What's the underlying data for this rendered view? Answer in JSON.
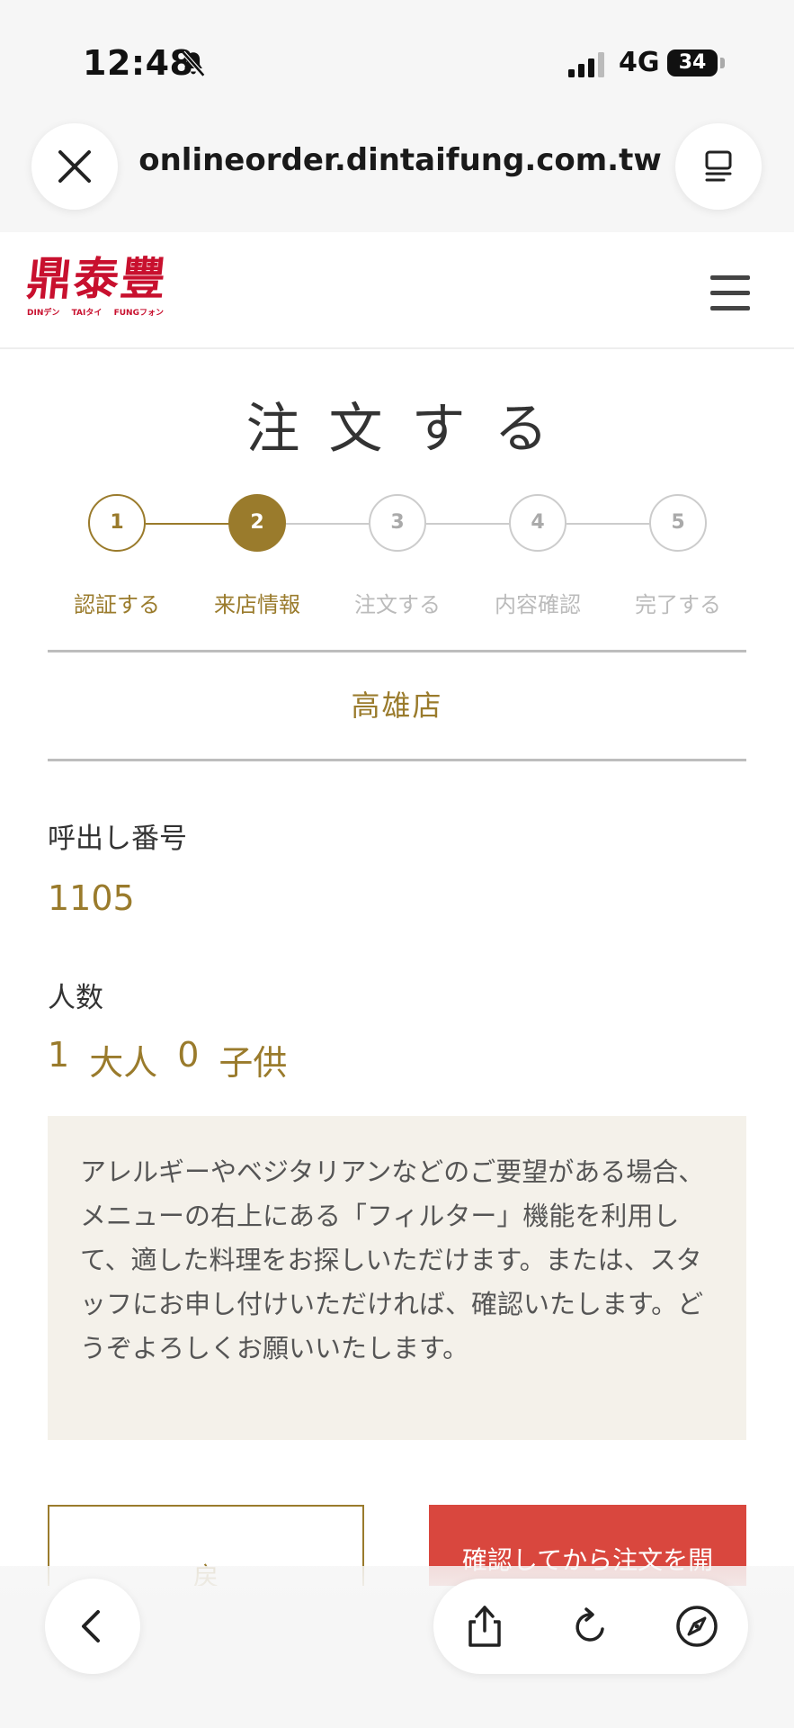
{
  "status_bar": {
    "time": "12:48",
    "network": "4G",
    "battery": "34"
  },
  "browser": {
    "url": "onlineorder.dintaifung.com.tw",
    "close_icon": "close-icon",
    "reader_icon": "reader-mode-icon"
  },
  "header": {
    "logo_text": "鼎泰豐",
    "logo_romaji": [
      "DINデン",
      "TAIタイ",
      "FUNGフォン"
    ],
    "menu_icon": "hamburger-menu-icon"
  },
  "page": {
    "title": "注文する",
    "steps": [
      {
        "number": "1",
        "label": "認証する",
        "state": "completed"
      },
      {
        "number": "2",
        "label": "来店情報",
        "state": "current"
      },
      {
        "number": "3",
        "label": "注文する",
        "state": "upcoming"
      },
      {
        "number": "4",
        "label": "内容確認",
        "state": "upcoming"
      },
      {
        "number": "5",
        "label": "完了する",
        "state": "upcoming"
      }
    ],
    "store_name": "高雄店",
    "call_number_label": "呼出し番号",
    "call_number_value": "1105",
    "party_label": "人数",
    "party": {
      "adults_count": "1",
      "adults_label": "大人",
      "children_count": "0",
      "children_label": "子供"
    },
    "notice": "アレルギーやベジタリアンなどのご要望がある場合、メニューの右上にある「フィルター」機能を利用して、適した料理をお探しいただけます。または、スタッフにお申し付けいただければ、確認いたします。どうぞよろしくお願いいたします。",
    "back_button_label": "戻",
    "confirm_button_label": "確認してから注文を開"
  },
  "colors": {
    "accent_gold": "#9a7b2c",
    "brand_red": "#c8102e",
    "confirm_red": "#d9473e",
    "notice_bg": "#f4f1ea"
  },
  "toolbar": {
    "back_icon": "chevron-left-icon",
    "share_icon": "share-icon",
    "reload_icon": "reload-icon",
    "compass_icon": "compass-icon"
  }
}
